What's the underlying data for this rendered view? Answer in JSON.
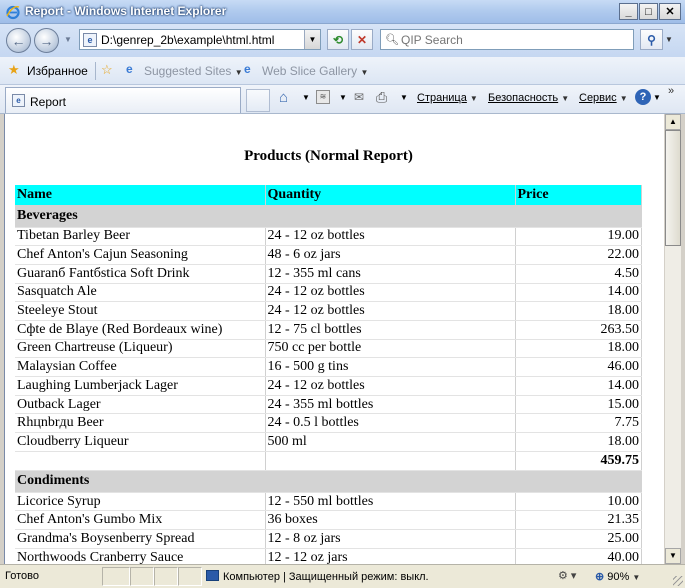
{
  "window": {
    "title": "Report - Windows Internet Explorer",
    "minimize": "_",
    "maximize": "□",
    "close": "✕"
  },
  "nav": {
    "address": "D:\\genrep_2b\\example\\html.html",
    "search_placeholder": "QIP Search"
  },
  "favorites": {
    "label": "Избранное",
    "items": [
      "Suggested Sites",
      "Web Slice Gallery"
    ]
  },
  "tab": {
    "label": "Report"
  },
  "commands": {
    "page": "Страница",
    "safety": "Безопасность",
    "tools": "Сервис"
  },
  "report": {
    "title": "Products (Normal Report)",
    "columns": [
      "Name",
      "Quantity",
      "Price"
    ],
    "groups": [
      {
        "name": "Beverages",
        "rows": [
          [
            "Tibetan Barley Beer",
            "24 - 12 oz bottles",
            "19.00"
          ],
          [
            "Chef Anton's Cajun Seasoning",
            "48 - 6 oz jars",
            "22.00"
          ],
          [
            "Guaranб Fantбstica Soft Drink",
            "12 - 355 ml cans",
            "4.50"
          ],
          [
            "Sasquatch Ale",
            "24 - 12 oz bottles",
            "14.00"
          ],
          [
            "Steeleye Stout",
            "24 - 12 oz bottles",
            "18.00"
          ],
          [
            "Cфte de Blaye (Red Bordeaux wine)",
            "12 - 75 cl bottles",
            "263.50"
          ],
          [
            "Green Chartreuse (Liqueur)",
            "750 cc per bottle",
            "18.00"
          ],
          [
            "Malaysian Coffee",
            "16 - 500 g tins",
            "46.00"
          ],
          [
            "Laughing Lumberjack Lager",
            "24 - 12 oz bottles",
            "14.00"
          ],
          [
            "Outback Lager",
            "24 - 355 ml bottles",
            "15.00"
          ],
          [
            "Rhцnbrдu Beer",
            "24 - 0.5 l bottles",
            "7.75"
          ],
          [
            "Cloudberry Liqueur",
            "500 ml",
            "18.00"
          ]
        ],
        "total": "459.75"
      },
      {
        "name": "Condiments",
        "rows": [
          [
            "Licorice Syrup",
            "12 - 550 ml bottles",
            "10.00"
          ],
          [
            "Chef Anton's Gumbo Mix",
            "36 boxes",
            "21.35"
          ],
          [
            "Grandma's Boysenberry Spread",
            "12 - 8 oz jars",
            "25.00"
          ],
          [
            "Northwoods Cranberry Sauce",
            "12 - 12 oz jars",
            "40.00"
          ]
        ]
      }
    ]
  },
  "status": {
    "text": "Готово",
    "zone": "Компьютер | Защищенный режим: выкл.",
    "zoom": "90%"
  }
}
